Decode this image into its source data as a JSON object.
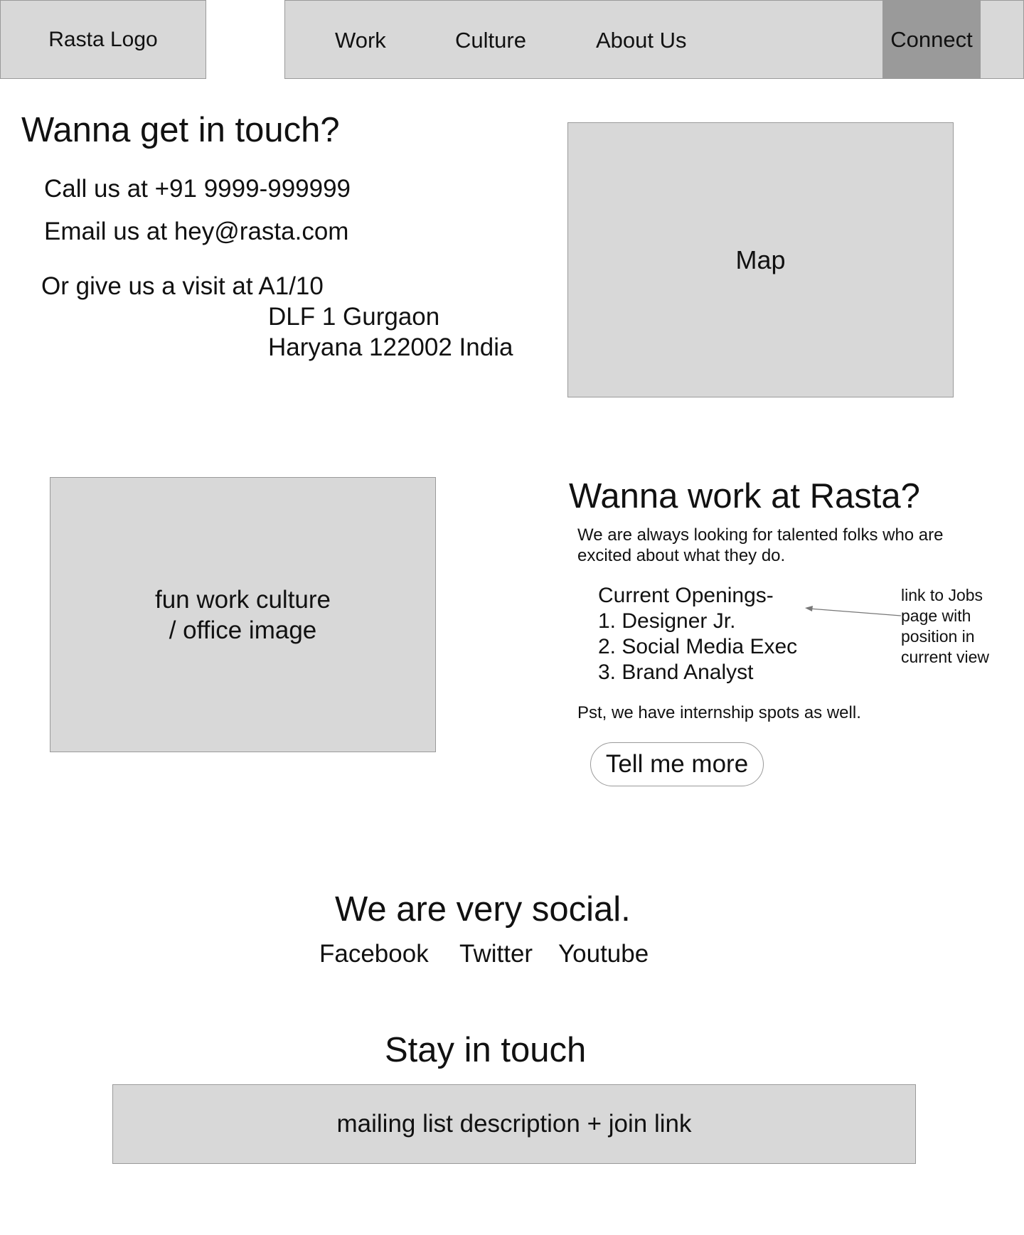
{
  "header": {
    "logo": "Rasta Logo",
    "nav": [
      "Work",
      "Culture",
      "About Us"
    ],
    "connect": "Connect"
  },
  "contact": {
    "title": "Wanna get in touch?",
    "call": "Call us at +91 9999-999999",
    "email": "Email us at hey@rasta.com",
    "visit_prefix": "Or give us a visit at A1/10",
    "address_line2": "DLF 1 Gurgaon",
    "address_line3": "Haryana 122002 India",
    "map_label": "Map"
  },
  "careers": {
    "image_label_line1": "fun work culture",
    "image_label_line2": "/ office image",
    "title": "Wanna work at Rasta?",
    "intro_line1": "We are always looking for talented folks who are",
    "intro_line2": "excited about what they do.",
    "openings_heading": "Current Openings-",
    "openings": [
      "1. Designer Jr.",
      "2. Social Media Exec",
      "3. Brand Analyst"
    ],
    "internship_note": "Pst, we have internship spots as well.",
    "button_label": "Tell me more",
    "annotation": "link to Jobs page with position in current view"
  },
  "social": {
    "title": "We are very social.",
    "links": [
      "Facebook",
      "Twitter",
      "Youtube"
    ]
  },
  "newsletter": {
    "title": "Stay in touch",
    "box_label": "mailing list description + join link"
  },
  "colors": {
    "placeholder_fill": "#d8d8d8",
    "active_nav": "#9a9a9a",
    "border": "#9a9a9a"
  }
}
